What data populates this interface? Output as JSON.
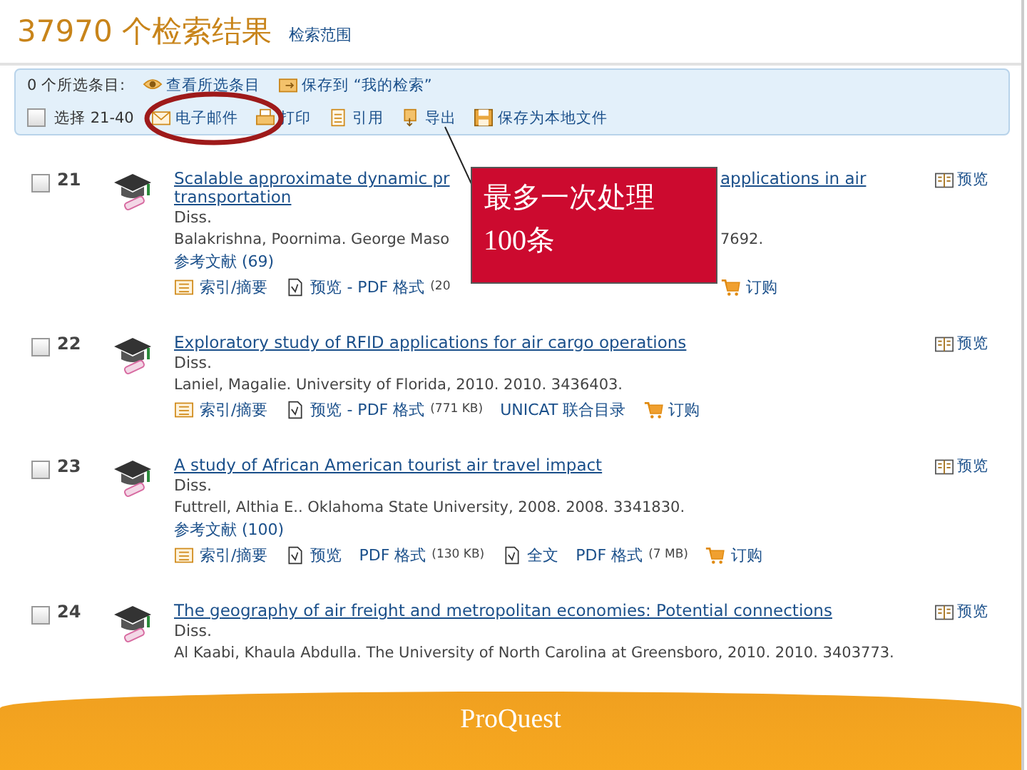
{
  "header": {
    "count_title": "37970 个检索结果",
    "scope_link": "检索范围"
  },
  "toolbar": {
    "selected_count": "0 个所选条目:",
    "top_actions": [
      {
        "kind": "eye",
        "label": "查看所选条目"
      },
      {
        "kind": "folder",
        "label": "保存到 “我的检索”"
      }
    ],
    "select_range": {
      "label": "选择 21-40",
      "checked": false
    },
    "actions": [
      {
        "kind": "mail",
        "label": "电子邮件"
      },
      {
        "kind": "print",
        "label": "打印"
      },
      {
        "kind": "cite",
        "label": "引用"
      },
      {
        "kind": "export",
        "label": "导出"
      },
      {
        "kind": "save",
        "label": "保存为本地文件"
      }
    ]
  },
  "records": [
    {
      "number": "21",
      "checked": false,
      "title": [
        [
          "Scalable approximate dynamic pr",
          "applications in air"
        ],
        [
          "transportation"
        ]
      ],
      "type": "Diss.",
      "citation": [
        "Balakrishna, Poornima. George Maso",
        "7692."
      ],
      "references": "参考文献 (69)",
      "links": [
        [
          {
            "kind": "abstract",
            "label": "索引/摘要"
          },
          {
            "kind": "preview",
            "label": "预览 - PDF 格式",
            "size": "(20"
          }
        ],
        [
          {
            "kind": "order",
            "label": "订购"
          }
        ]
      ],
      "preview": "预览"
    },
    {
      "number": "22",
      "checked": false,
      "title": [
        [
          "Exploratory study of RFID applications for air cargo operations"
        ]
      ],
      "type": "Diss.",
      "citation": [
        "Laniel, Magalie. University of Florida, 2010. 2010. 3436403."
      ],
      "links": [
        [
          {
            "kind": "abstract",
            "label": "索引/摘要"
          },
          {
            "kind": "preview",
            "label": "预览 - PDF 格式",
            "size": "(771 KB)"
          },
          {
            "kind": "text",
            "label": "UNICAT 联合目录"
          },
          {
            "kind": "order",
            "label": "订购"
          }
        ]
      ],
      "preview": "预览"
    },
    {
      "number": "23",
      "checked": false,
      "title": [
        [
          "A study of African American tourist air travel impact"
        ]
      ],
      "type": "Diss.",
      "citation": [
        "Futtrell, Althia E.. Oklahoma State University, 2008. 2008. 3341830."
      ],
      "references": "参考文献 (100)",
      "links": [
        [
          {
            "kind": "abstract",
            "label": "索引/摘要"
          },
          {
            "kind": "preview",
            "label": "预览"
          },
          {
            "kind": "text",
            "label": "PDF 格式",
            "size": "(130 KB)"
          },
          {
            "kind": "fulltext",
            "label": "全文"
          },
          {
            "kind": "text",
            "label": "PDF 格式",
            "size": "(7 MB)"
          },
          {
            "kind": "order",
            "label": "订购"
          }
        ]
      ],
      "preview": "预览"
    },
    {
      "number": "24",
      "checked": false,
      "title": [
        [
          "The geography of air freight and metropolitan economies: Potential connections"
        ]
      ],
      "type": "Diss.",
      "citation": [
        "Al Kaabi, Khaula Abdulla. The University of North Carolina at Greensboro, 2010. 2010. 3403773."
      ],
      "preview": "预览"
    }
  ],
  "callout": {
    "lines": [
      "最多一次处理",
      "100条"
    ]
  },
  "footer": {
    "logo": "ProQuest"
  }
}
